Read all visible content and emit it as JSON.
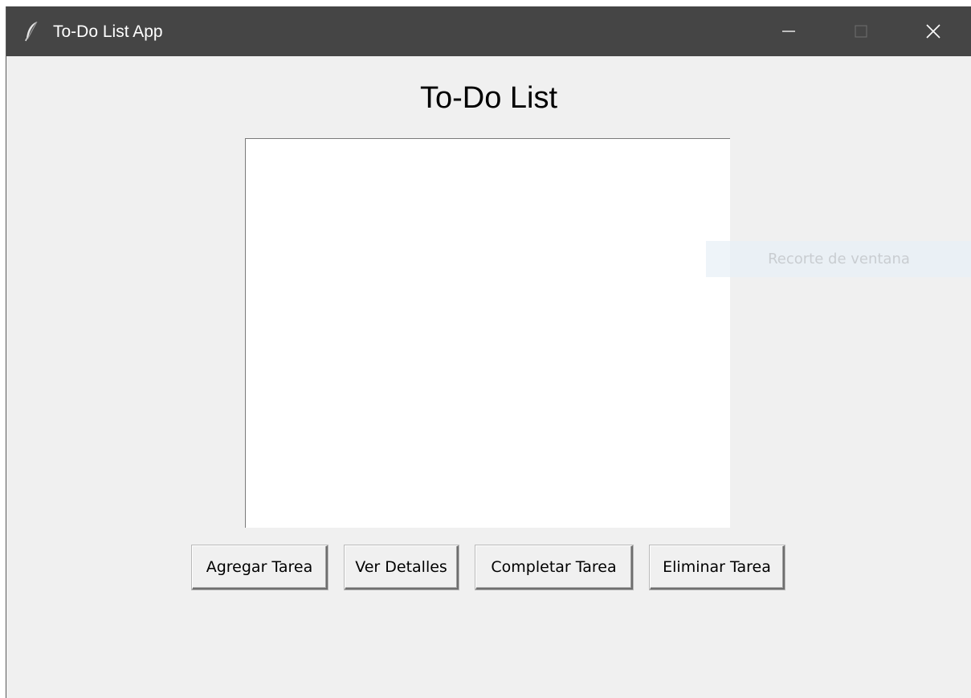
{
  "window": {
    "title": "To-Do List App",
    "icon": "feather-icon",
    "controls": [
      "minimize-icon",
      "maximize-icon",
      "close-icon"
    ]
  },
  "main": {
    "heading": "To-Do List",
    "tasks": []
  },
  "buttons": {
    "add": "Agregar Tarea",
    "details": "Ver Detalles",
    "complete": "Completar Tarea",
    "delete": "Eliminar Tarea"
  },
  "overlay": {
    "snip_label": "Recorte de ventana"
  },
  "colors": {
    "titlebar": "#454545",
    "background": "#f0f0f0",
    "listbox": "#ffffff"
  }
}
